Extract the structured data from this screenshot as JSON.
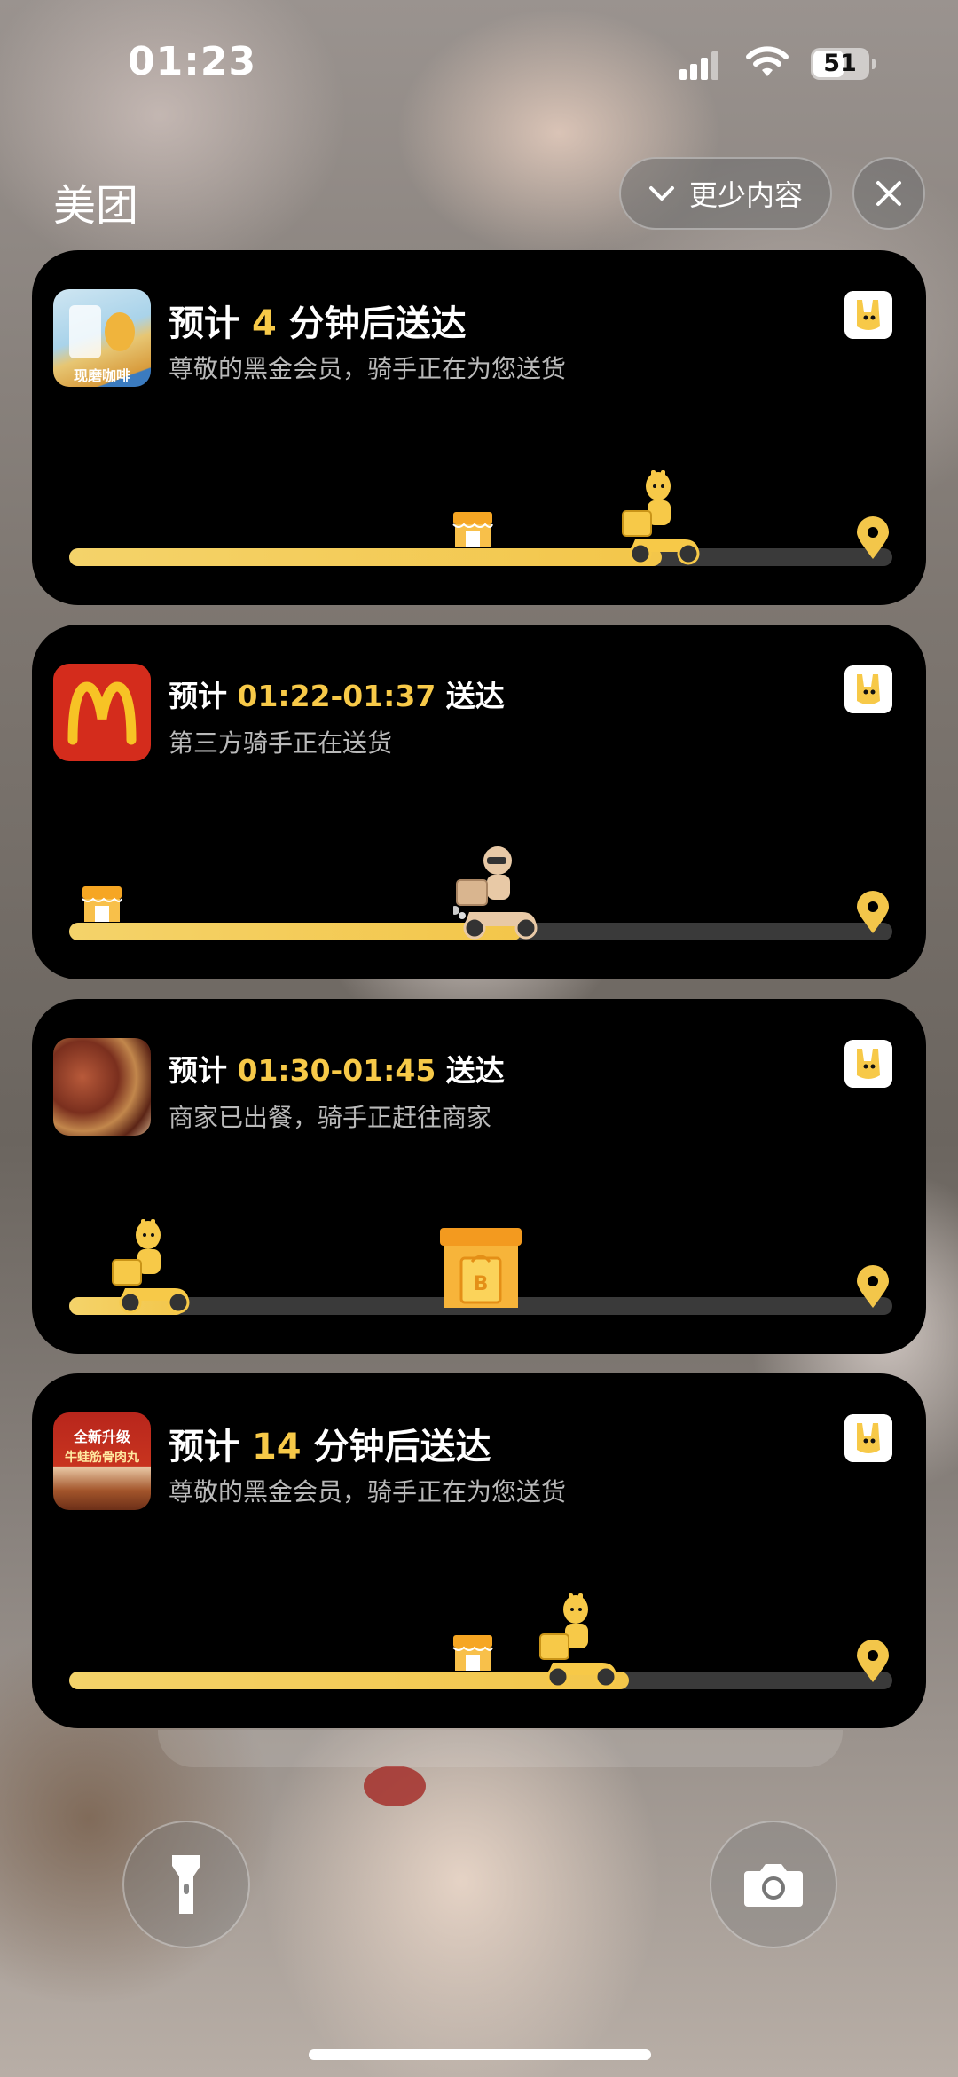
{
  "status_bar": {
    "time": "01:23",
    "battery": "51"
  },
  "header": {
    "app_name": "美团",
    "less_content_label": "更少内容"
  },
  "cards": [
    {
      "title_prefix": "预计",
      "title_highlight": "4",
      "title_suffix": "分钟后送达",
      "subtitle": "尊敬的黑金会员，骑手正在为您送货",
      "thumb_caption": "现磨咖啡",
      "progress": 0.72,
      "store_position": 0.49,
      "rider_position": 0.72
    },
    {
      "title_prefix": "预计",
      "title_highlight": "01:22-01:37",
      "title_suffix": "送达",
      "subtitle": "第三方骑手正在送货",
      "progress": 0.55,
      "store_position": 0.04,
      "rider_position": 0.52
    },
    {
      "title_prefix": "预计",
      "title_highlight": "01:30-01:45",
      "title_suffix": "送达",
      "subtitle": "商家已出餐，骑手正赶往商家",
      "progress": 0.14,
      "store_position": 0.5,
      "rider_position": 0.1
    },
    {
      "title_prefix": "预计",
      "title_highlight": "14",
      "title_suffix": "分钟后送达",
      "subtitle": "尊敬的黑金会员，骑手正在为您送货",
      "thumb_caption_1": "全新升级",
      "thumb_caption_2": "牛蛙筋骨肉丸",
      "progress": 0.68,
      "store_position": 0.49,
      "rider_position": 0.62
    }
  ],
  "icons": {
    "close": "close-icon",
    "chevron": "chevron-down-icon",
    "flashlight": "flashlight-icon",
    "camera": "camera-icon",
    "brand": "meituan-kangaroo-icon",
    "pin": "destination-pin-icon",
    "store": "store-icon",
    "rider": "rider-icon"
  },
  "colors": {
    "accent": "#f7c948",
    "card_bg": "#000000",
    "track": "#3a3a3a"
  }
}
